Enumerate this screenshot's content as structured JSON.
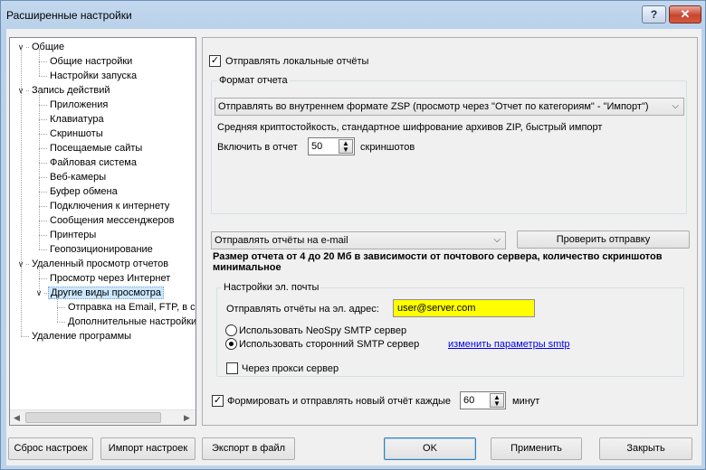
{
  "window": {
    "title": "Расширенные настройки",
    "help_label": "?",
    "close_label": "✕"
  },
  "tree": {
    "items": [
      {
        "label": "Общие",
        "level": 0,
        "expanded": true
      },
      {
        "label": "Общие настройки",
        "level": 1
      },
      {
        "label": "Настройки запуска",
        "level": 1
      },
      {
        "label": "Запись действий",
        "level": 0,
        "expanded": true
      },
      {
        "label": "Приложения",
        "level": 1
      },
      {
        "label": "Клавиатура",
        "level": 1
      },
      {
        "label": "Скриншоты",
        "level": 1
      },
      {
        "label": "Посещаемые сайты",
        "level": 1
      },
      {
        "label": "Файловая система",
        "level": 1
      },
      {
        "label": "Веб-камеры",
        "level": 1
      },
      {
        "label": "Буфер обмена",
        "level": 1
      },
      {
        "label": "Подключения к интернету",
        "level": 1
      },
      {
        "label": "Сообщения мессенджеров",
        "level": 1
      },
      {
        "label": "Принтеры",
        "level": 1
      },
      {
        "label": "Геопозиционирование",
        "level": 1
      },
      {
        "label": "Удаленный просмотр отчетов",
        "level": 0,
        "expanded": true
      },
      {
        "label": "Просмотр через Интернет",
        "level": 1
      },
      {
        "label": "Другие виды просмотра",
        "level": 1,
        "expanded": true,
        "selected": true
      },
      {
        "label": "Отправка на Email, FTP, в сеть",
        "level": 2
      },
      {
        "label": "Дополнительные настройки",
        "level": 2
      },
      {
        "label": "Удаление программы",
        "level": 0
      }
    ],
    "scroll_left": "◀",
    "scroll_right": "▶"
  },
  "local": {
    "send_local_label": "Отправлять локальные отчёты",
    "send_local_checked": "✓",
    "format_group_title": "Формат отчета",
    "format_value": "Отправлять во внутреннем формате ZSP  (просмотр через \"Отчет по категориям\" - \"Импорт\")",
    "format_desc": "Средняя криптостойкость, стандартное шифрование архивов ZIP, быстрый импорт",
    "include_label": "Включить в отчет",
    "include_value": "50",
    "include_unit": "скриншотов"
  },
  "email": {
    "method_value": "Отправлять отчёты на e-mail",
    "test_button": "Проверить отправку",
    "size_note": "Размер отчета от 4 до 20 Мб в зависимости от почтового сервера, количество скриншотов минимальное",
    "settings_group_title": "Настройки эл. почты",
    "address_label": "Отправлять отчёты на эл. адрес:",
    "address_value": "user@server.com",
    "smtp_neospy": "Использовать NeoSpy SMTP сервер",
    "smtp_third": "Использовать сторонний SMTP сервер",
    "smtp_link": "изменить параметры smtp",
    "proxy_label": "Через прокси сервер",
    "form_label": "Формировать и отправлять новый отчёт  каждые",
    "form_checked": "✓",
    "form_value": "60",
    "form_unit": "минут"
  },
  "buttons": {
    "reset": "Сброс настроек",
    "import": "Импорт настроек",
    "export": "Экспорт в файл",
    "ok": "OK",
    "apply": "Применить",
    "close": "Закрыть"
  },
  "icons": {
    "chevron": "⌵",
    "spin_up": "▲",
    "spin_down": "▼"
  }
}
